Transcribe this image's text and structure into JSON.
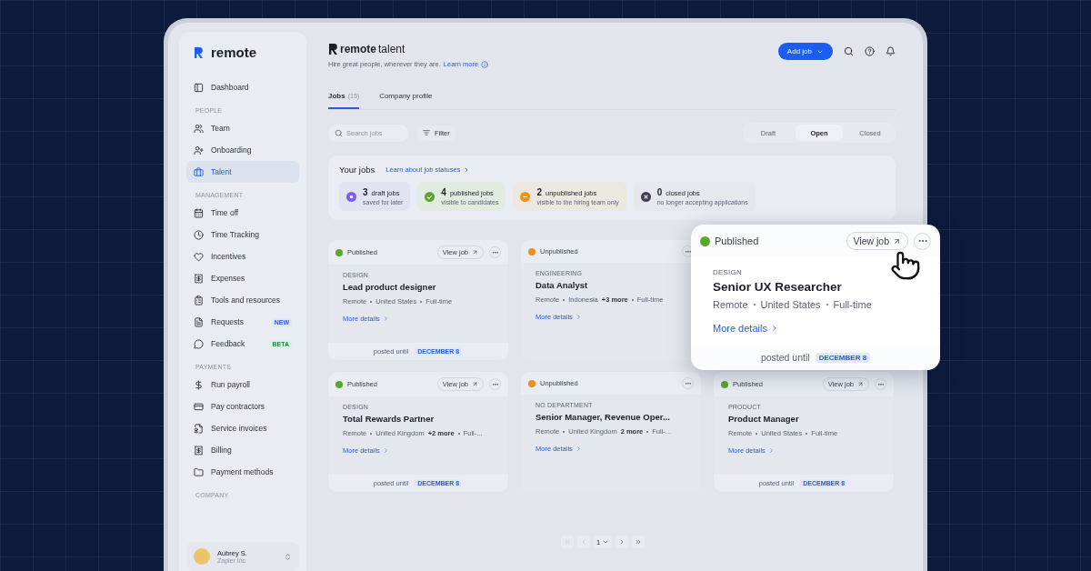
{
  "sidebar": {
    "logo": "remote",
    "sections": [
      {
        "items": [
          {
            "label": "Dashboard",
            "selected": false
          }
        ]
      },
      {
        "heading": "PEOPLE",
        "items": [
          {
            "label": "Team",
            "selected": false
          },
          {
            "label": "Onboarding",
            "selected": false
          },
          {
            "label": "Talent",
            "selected": true
          }
        ]
      },
      {
        "heading": "MANAGEMENT",
        "items": [
          {
            "label": "Time off",
            "selected": false
          },
          {
            "label": "Time Tracking",
            "selected": false
          },
          {
            "label": "Incentives",
            "selected": false
          },
          {
            "label": "Expenses",
            "selected": false
          },
          {
            "label": "Tools and resources",
            "selected": false
          },
          {
            "label": "Requests",
            "selected": false,
            "badge": {
              "kind": "new",
              "text": "NEW"
            }
          },
          {
            "label": "Feedback",
            "selected": false,
            "badge": {
              "kind": "beta",
              "text": "BETA"
            }
          }
        ]
      },
      {
        "heading": "PAYMENTS",
        "items": [
          {
            "label": "Run payroll",
            "selected": false
          },
          {
            "label": "Pay contractors",
            "selected": false
          },
          {
            "label": "Service invoices",
            "selected": false
          },
          {
            "label": "Billing",
            "selected": false
          },
          {
            "label": "Payment methods",
            "selected": false
          }
        ]
      },
      {
        "heading": "COMPANY"
      }
    ],
    "user": {
      "name": "Aubrey S.",
      "company": "Zapier Inc"
    }
  },
  "header": {
    "brand": "remote",
    "product": "talent",
    "tagline": "Hire great people, wherever they are.",
    "link": "Learn more",
    "add_button": "Add job"
  },
  "tabs": [
    {
      "label": "Jobs",
      "count": "(15)",
      "selected": true
    },
    {
      "label": "Company profile",
      "selected": false
    }
  ],
  "search": {
    "placeholder": "Search jobs"
  },
  "filter": "Filter",
  "segments": [
    {
      "label": "Draft",
      "selected": false
    },
    {
      "label": "Open",
      "selected": true
    },
    {
      "label": "Closed",
      "selected": false
    }
  ],
  "summary": {
    "title": "Your jobs",
    "link": "Learn about job statuses",
    "stats": [
      {
        "kind": "draft",
        "count": "3",
        "label": "draft jobs",
        "sub": "saved for later"
      },
      {
        "kind": "published",
        "count": "4",
        "label": "published jobs",
        "sub": "visible to candidates"
      },
      {
        "kind": "unpublished",
        "count": "2",
        "label": "unpublished jobs",
        "sub": "visible to the hiring team only"
      },
      {
        "kind": "closed",
        "count": "0",
        "label": "closed jobs",
        "sub": "no longer accepting applications"
      }
    ]
  },
  "cards": [
    {
      "kind": "published",
      "status_label": "Published",
      "view": "View job",
      "department": "DESIGN",
      "title": "Lead product designer",
      "location": [
        {
          "text": "Remote"
        },
        {
          "text": "United States"
        },
        {
          "text": "Full-time"
        }
      ],
      "details": "More details",
      "posted": "posted until",
      "date": "DECEMBER 8"
    },
    {
      "kind": "unpublished",
      "status_label": "Unpublished",
      "department": "ENGINEERING",
      "title": "Data Analyst",
      "location": [
        {
          "text": "Remote"
        },
        {
          "text": "Indonesia",
          "more": "+3 more"
        },
        {
          "text": "Full-time"
        }
      ],
      "details": "More details"
    },
    {
      "kind": "published",
      "status_label": "Published",
      "view": "View job",
      "department": "DESIGN",
      "title": "Total Rewards Partner",
      "location": [
        {
          "text": "Remote"
        },
        {
          "text": "United Kingdom",
          "more": "+2 more"
        },
        {
          "text": "Full-..."
        }
      ],
      "details": "More details",
      "posted": "posted until",
      "date": "DECEMBER 8"
    },
    {
      "kind": "unpublished",
      "status_label": "Unpublished",
      "department": "NO DEPARTMENT",
      "title": "Senior Manager, Revenue Oper...",
      "location": [
        {
          "text": "Remote"
        },
        {
          "text": "United Kingdom",
          "more": "2 more"
        },
        {
          "text": "Full-..."
        }
      ],
      "details": "More details"
    },
    {
      "kind": "published",
      "status_label": "Published",
      "view": "View job",
      "department": "PRODUCT",
      "title": "Product Manager",
      "location": [
        {
          "text": "Remote"
        },
        {
          "text": "United States"
        },
        {
          "text": "Full-time"
        }
      ],
      "details": "More details",
      "posted": "posted until",
      "date": "DECEMBER 8"
    }
  ],
  "pagination": {
    "page": "1"
  },
  "popup": {
    "kind": "published",
    "status_label": "Published",
    "view": "View job",
    "department": "DESIGN",
    "title": "Senior UX Researcher",
    "location": [
      {
        "text": "Remote"
      },
      {
        "text": "United States"
      },
      {
        "text": "Full-time"
      }
    ],
    "details": "More details",
    "posted": "posted until",
    "date": "DECEMBER 8"
  }
}
